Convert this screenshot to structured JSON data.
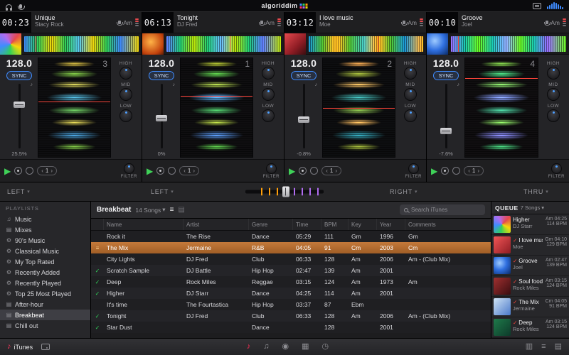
{
  "topbar": {
    "logo": "algoriddim"
  },
  "icons": {
    "chevron_down": "▾",
    "check": "✓",
    "play": "▶",
    "note": "♪",
    "notes": "♫",
    "lines": "≡",
    "disc": "◉",
    "grid": "▦",
    "clock": "◷",
    "mixer": "▥",
    "panel": "▤",
    "gear": "⚙",
    "arrow_left": "‹",
    "arrow_right": "›"
  },
  "deck_labels": {
    "sync": "SYNC",
    "filter": "FILTER",
    "loop": "1",
    "eq": [
      "HIGH",
      "MID",
      "LOW"
    ]
  },
  "decks": [
    {
      "number": "3",
      "time": "00:23",
      "title": "Unique",
      "artist": "Stacy Rock",
      "key": "Am",
      "bpm": "128.0",
      "tempo": "25.5%"
    },
    {
      "number": "1",
      "time": "06:13",
      "title": "Tonight",
      "artist": "DJ Fred",
      "key": "Am",
      "bpm": "128.0",
      "tempo": "0%"
    },
    {
      "number": "2",
      "time": "03:12",
      "title": "I love music",
      "artist": "Moe",
      "key": "Am",
      "bpm": "128.0",
      "tempo": "-0.8%"
    },
    {
      "number": "4",
      "time": "00:10",
      "title": "Groove",
      "artist": "Joel",
      "key": "Am",
      "bpm": "128.0",
      "tempo": "-7.6%"
    }
  ],
  "crossfader": {
    "assignments": [
      "LEFT",
      "LEFT",
      "RIGHT",
      "THRU"
    ]
  },
  "sidebar": {
    "title": "PLAYLISTS",
    "items": [
      "Music",
      "Mixes",
      "90's Music",
      "Classical Music",
      "My Top Rated",
      "Recently Added",
      "Recently Played",
      "Top 25 Most Played",
      "After-hour",
      "Breakbeat",
      "Chill out"
    ],
    "selected": "Breakbeat"
  },
  "browser": {
    "title": "Breakbeat",
    "count": "14 Songs",
    "search_placeholder": "Search iTunes",
    "columns": [
      "Name",
      "Artist",
      "Genre",
      "Time",
      "BPM",
      "Key",
      "Year",
      "Comments"
    ],
    "rows": [
      {
        "name": "Rock it",
        "artist": "The Rise",
        "genre": "Dance",
        "time": "05:29",
        "bpm": "111",
        "key": "Gm",
        "year": "1996",
        "comments": "Gm",
        "checked": false,
        "selected": false
      },
      {
        "name": "The Mix",
        "artist": "Jermaine",
        "genre": "R&B",
        "time": "04:05",
        "bpm": "91",
        "key": "Cm",
        "year": "2003",
        "comments": "Cm",
        "checked": false,
        "selected": true
      },
      {
        "name": "City Lights",
        "artist": "DJ Fred",
        "genre": "Club",
        "time": "06:33",
        "bpm": "128",
        "key": "Am",
        "year": "2006",
        "comments": "Am - (Club Mix)",
        "checked": false,
        "selected": false
      },
      {
        "name": "Scratch Sample",
        "artist": "DJ Battle",
        "genre": "Hip Hop",
        "time": "02:47",
        "bpm": "139",
        "key": "Am",
        "year": "2001",
        "comments": "",
        "checked": true,
        "selected": false
      },
      {
        "name": "Deep",
        "artist": "Rock Miles",
        "genre": "Reggae",
        "time": "03:15",
        "bpm": "124",
        "key": "Am",
        "year": "1973",
        "comments": "Am",
        "checked": true,
        "selected": false
      },
      {
        "name": "Higher",
        "artist": "DJ Starr",
        "genre": "Dance",
        "time": "04:25",
        "bpm": "114",
        "key": "Am",
        "year": "2001",
        "comments": "",
        "checked": true,
        "selected": false
      },
      {
        "name": "It's time",
        "artist": "The Fourtastica",
        "genre": "Hip Hop",
        "time": "03:37",
        "bpm": "87",
        "key": "Ebm",
        "year": "",
        "comments": "",
        "checked": false,
        "selected": false
      },
      {
        "name": "Tonight",
        "artist": "DJ Fred",
        "genre": "Club",
        "time": "06:33",
        "bpm": "128",
        "key": "Am",
        "year": "2006",
        "comments": "Am - (Club Mix)",
        "checked": true,
        "selected": false
      },
      {
        "name": "Star Dust",
        "artist": "",
        "genre": "Dance",
        "time": "",
        "bpm": "128",
        "key": "",
        "year": "2001",
        "comments": "",
        "checked": true,
        "selected": false
      }
    ]
  },
  "queue": {
    "title": "QUEUE",
    "count": "7 Songs",
    "items": [
      {
        "title": "Higher",
        "artist": "DJ Starr",
        "key_time": "Am 04:25",
        "bpm": "114 BPM",
        "checked": false
      },
      {
        "title": "I love music",
        "artist": "Moe",
        "key_time": "Gm 04:10",
        "bpm": "129 BPM",
        "checked": true
      },
      {
        "title": "Groove",
        "artist": "Joel",
        "key_time": "Am 02:47",
        "bpm": "139 BPM",
        "checked": true
      },
      {
        "title": "Soul food",
        "artist": "Rock Miles",
        "key_time": "Am 03:15",
        "bpm": "124 BPM",
        "checked": true
      },
      {
        "title": "The Mix",
        "artist": "Jermaine",
        "key_time": "Cm 04:05",
        "bpm": "91 BPM",
        "checked": true
      },
      {
        "title": "Deep",
        "artist": "Rock Miles",
        "key_time": "Am 03:15",
        "bpm": "124 BPM",
        "checked": true
      }
    ]
  },
  "toolbar": {
    "itunes_label": "iTunes"
  },
  "colors": {
    "accent_blue": "#3f8cff",
    "play_green": "#3fd158",
    "selected_orange": "#b06a2c",
    "check_green": "#30d158",
    "check_red": "#ff453a",
    "active_pink": "#ff2d55"
  }
}
